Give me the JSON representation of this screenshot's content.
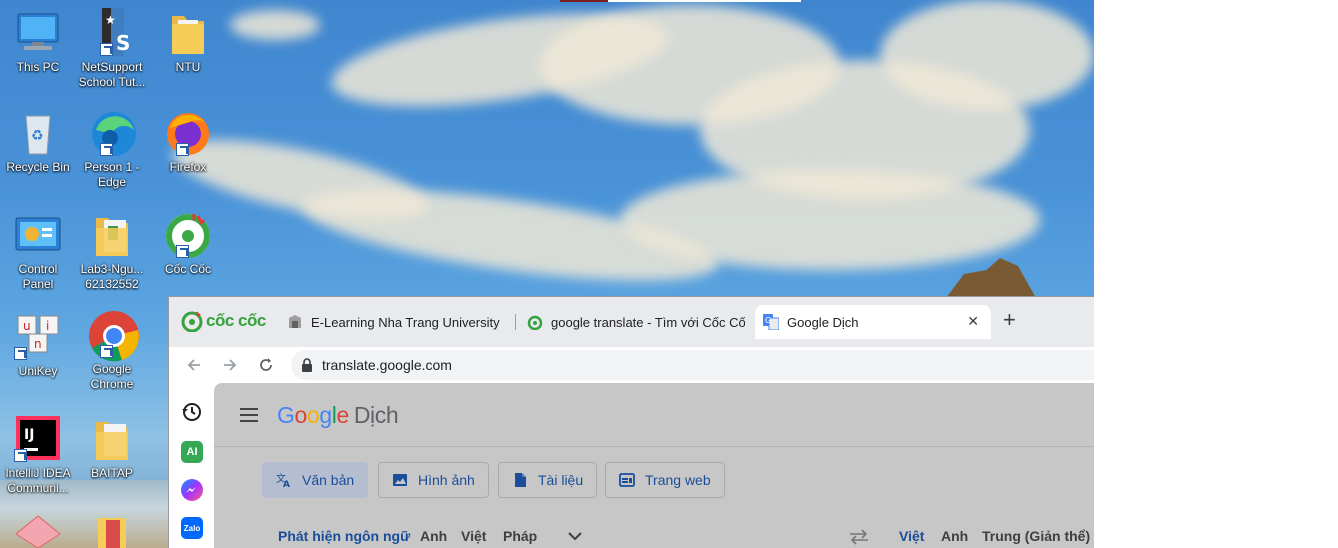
{
  "desktop": {
    "icons": [
      {
        "label": "This PC",
        "icon": "this-pc-icon"
      },
      {
        "label": "NetSupport\nSchool Tut...",
        "icon": "netsupport-icon"
      },
      {
        "label": "NTU",
        "icon": "folder-icon"
      },
      {
        "label": "Recycle Bin",
        "icon": "recycle-bin-icon"
      },
      {
        "label": "Person 1 -\nEdge",
        "icon": "edge-icon"
      },
      {
        "label": "Firefox",
        "icon": "firefox-icon"
      },
      {
        "label": "Control\nPanel",
        "icon": "control-panel-icon"
      },
      {
        "label": "Lab3-Ngu...\n62132552",
        "icon": "folder-icon"
      },
      {
        "label": "Cốc Cốc",
        "icon": "coccoc-icon"
      },
      {
        "label": "UniKey",
        "icon": "unikey-icon"
      },
      {
        "label": "Google\nChrome",
        "icon": "chrome-icon"
      },
      {
        "label": "IntelliJ IDEA\nCommuni...",
        "icon": "intellij-icon"
      },
      {
        "label": "BAITAP",
        "icon": "folder-icon"
      }
    ]
  },
  "browser": {
    "brand": "cốc cốc",
    "tabs": [
      {
        "title": "E-Learning Nha Trang University",
        "icon": "elearning-icon"
      },
      {
        "title": "google translate - Tìm với Cốc Cốc",
        "icon": "coccoc-icon"
      },
      {
        "title": "Google Dịch",
        "icon": "google-translate-icon",
        "active": true
      }
    ],
    "new_tab": "+",
    "close_tab": "✕",
    "url": "translate.google.com"
  },
  "translate": {
    "logo_google": "Google",
    "logo_suffix": "Dịch",
    "modes": [
      "Văn bản",
      "Hình ảnh",
      "Tài liệu",
      "Trang web"
    ],
    "source_langs": [
      "Phát hiện ngôn ngữ",
      "Anh",
      "Việt",
      "Pháp"
    ],
    "target_langs": [
      "Việt",
      "Anh",
      "Trung (Giản thể)"
    ]
  },
  "colors": {
    "accent": "#1a4d9a",
    "coccoc_green": "#35a23e"
  }
}
